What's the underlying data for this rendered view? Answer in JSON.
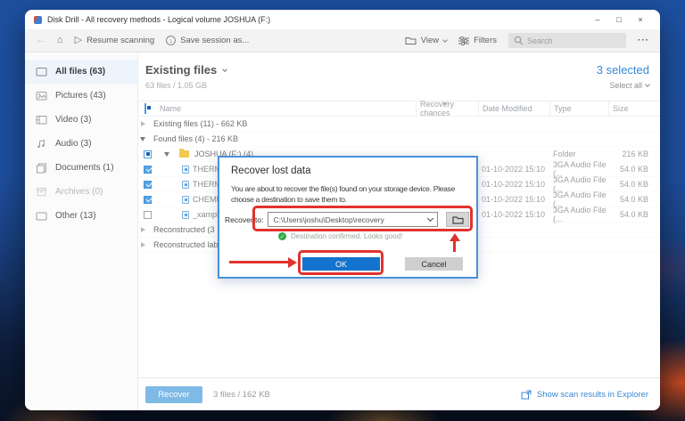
{
  "window": {
    "title": "Disk Drill - All recovery methods - Logical volume JOSHUA (F:)"
  },
  "icons": {
    "back": "←",
    "home": "⌂",
    "play": "▷",
    "save_arrow": "↓",
    "more": "···",
    "minimize": "–",
    "maximize": "□",
    "close": "×",
    "confirm_check": "✓"
  },
  "toolbar": {
    "resume_label": "Resume scanning",
    "save_session_label": "Save session as...",
    "view_label": "View",
    "filters_label": "Filters",
    "search_placeholder": "Search"
  },
  "sidebar": {
    "items": [
      {
        "label": "All files (63)",
        "icon": "all-files-icon",
        "state": "active"
      },
      {
        "label": "Pictures (43)",
        "icon": "pictures-icon",
        "state": "normal"
      },
      {
        "label": "Video (3)",
        "icon": "video-icon",
        "state": "normal"
      },
      {
        "label": "Audio (3)",
        "icon": "audio-icon",
        "state": "normal"
      },
      {
        "label": "Documents (1)",
        "icon": "documents-icon",
        "state": "normal"
      },
      {
        "label": "Archives (0)",
        "icon": "archives-icon",
        "state": "disabled"
      },
      {
        "label": "Other (13)",
        "icon": "other-icon",
        "state": "normal"
      }
    ]
  },
  "main": {
    "view_title": "Existing files",
    "files_summary": "63 files / 1.05 GB",
    "selected_count": "3 selected",
    "select_all_label": "Select all",
    "columns": {
      "name": "Name",
      "chance": "Recovery chances",
      "date": "Date Modified",
      "type": "Type",
      "size": "Size"
    },
    "rows": [
      {
        "kind": "group",
        "expanded": false,
        "label": "Existing files (11) - 662 KB"
      },
      {
        "kind": "group",
        "expanded": true,
        "label": "Found files (4) - 216 KB"
      },
      {
        "kind": "folder",
        "checkbox": "indeterminate",
        "label": "JOSHUA (F:) (4)",
        "date": "",
        "type": "Folder",
        "size": "216 KB"
      },
      {
        "kind": "file",
        "checkbox": "checked",
        "label": "THERMO",
        "date": "01-10-2022 15:10",
        "type": "3GA Audio File (...",
        "size": "54.0 KB"
      },
      {
        "kind": "file",
        "checkbox": "checked",
        "label": "THERMO",
        "date": "01-10-2022 15:10",
        "type": "3GA Audio File (...",
        "size": "54.0 KB"
      },
      {
        "kind": "file",
        "checkbox": "checked",
        "label": "CHEMIST",
        "date": "01-10-2022 15:10",
        "type": "3GA Audio File (...",
        "size": "54.0 KB"
      },
      {
        "kind": "file",
        "checkbox": "unchecked",
        "label": "_xample.3ga",
        "date": "01-10-2022 15:10",
        "type": "3GA Audio File (...",
        "size": "54.0 KB"
      },
      {
        "kind": "group",
        "expanded": false,
        "label": "Reconstructed (3"
      },
      {
        "kind": "group",
        "expanded": false,
        "label": "Reconstructed lab"
      }
    ]
  },
  "dialog": {
    "title": "Recover lost data",
    "body": "You are about to recover the file(s) found on your storage device. Please choose a destination to save them to.",
    "recover_to_label": "Recover to:",
    "path_value": "C:\\Users\\joshu\\Desktop\\recovery",
    "confirmation": "Destination confirmed. Looks good!",
    "ok_label": "OK",
    "cancel_label": "Cancel"
  },
  "footer": {
    "recover_label": "Recover",
    "selection_summary": "3 files / 162 KB",
    "show_results_label": "Show scan results in Explorer"
  },
  "colors": {
    "accent_blue": "#3787d6",
    "ok_button_blue": "#1473cc",
    "annotation_red": "#e0322e",
    "confirm_green": "#2fac46",
    "recover_button_blue": "#7fb9e6",
    "dialog_border_blue": "#4a90d9",
    "desktop_blue": "#1d509f",
    "folder_yellow": "#f3c84f"
  }
}
